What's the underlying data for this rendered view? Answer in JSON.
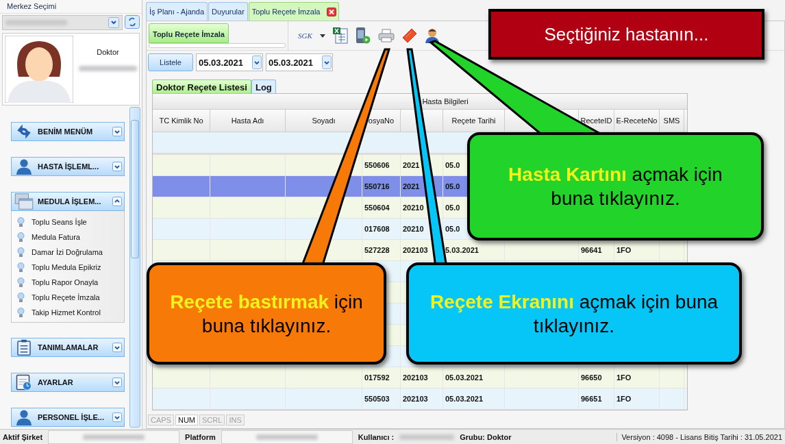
{
  "sidebar": {
    "center_label": "Merkez Seçimi",
    "role": "Doktor",
    "groups": [
      {
        "label": "BENİM MENÜM",
        "expanded": false
      },
      {
        "label": "HASTA İŞLEML...",
        "expanded": false
      },
      {
        "label": "MEDULA İŞLEM...",
        "expanded": true,
        "items": [
          "Toplu Seans İşle",
          "Medula Fatura",
          "Damar İzi Doğrulama",
          "Toplu Medula Epikriz",
          "Toplu Rapor Onayla",
          "Toplu Reçete İmzala",
          "Takip Hizmet Kontrol"
        ]
      },
      {
        "label": "TANIMLAMALAR",
        "expanded": false
      },
      {
        "label": "AYARLAR",
        "expanded": false
      },
      {
        "label": "PERSONEL İŞLE...",
        "expanded": false
      }
    ]
  },
  "tabs": [
    {
      "label": "İş Planı - Ajanda",
      "selected": false
    },
    {
      "label": "Duyurular",
      "selected": false
    },
    {
      "label": "Toplu Reçete İmzala",
      "selected": true
    }
  ],
  "ribbon_tab": "Toplu Reçete İmzala",
  "sgk_logo": "SGK",
  "list_button": "Listele",
  "date_from": "05.03.2021",
  "date_to": "05.03.2021",
  "inner_tabs": [
    {
      "label": "Doktor Reçete Listesi",
      "selected": true
    },
    {
      "label": "Log",
      "selected": false
    }
  ],
  "table": {
    "group_header": "Hasta Bilgileri",
    "columns": [
      {
        "label": "TC Kimlik No"
      },
      {
        "label": "Hasta Adı"
      },
      {
        "label": "Soyadı"
      },
      {
        "label": "osyaNo"
      },
      {},
      {
        "label": "Reçete Tarihi"
      },
      {},
      {
        "label": "ReceteID"
      },
      {
        "label": "E-ReceteNo"
      },
      {
        "label": "SMS"
      }
    ],
    "rows": [
      {
        "selected": false,
        "dosya_no": "550606",
        "column_5": "2021",
        "recete_tarihi": "05.0"
      },
      {
        "selected": true,
        "dosya_no": "550716",
        "column_5": "2021",
        "recete_tarihi": "05.0"
      },
      {
        "selected": false,
        "dosya_no": "550604",
        "column_5": "20210",
        "recete_tarihi": "05.0"
      },
      {
        "selected": false,
        "dosya_no": "017608",
        "column_5": "20210",
        "recete_tarihi": "05.0"
      },
      {
        "selected": false,
        "dosya_no": "527228",
        "column_5": "202103",
        "recete_tarihi": "5.03.2021",
        "recete_id": "96641",
        "e_recete_no": "1FO"
      },
      {
        "selected": false
      },
      {
        "selected": false
      },
      {
        "selected": false
      },
      {
        "selected": false
      },
      {
        "selected": false
      },
      {
        "selected": false,
        "dosya_no": "017592",
        "column_5": "202103",
        "recete_tarihi": "05.03.2021",
        "recete_id": "96650",
        "e_recete_no": "1FO"
      },
      {
        "selected": false,
        "dosya_no": "550503",
        "column_5": "202103",
        "recete_tarihi": "05.03.2021",
        "recete_id": "96651",
        "e_recete_no": "1FO"
      }
    ]
  },
  "key_indicators": [
    {
      "label": "CAPS",
      "on": false
    },
    {
      "label": "NUM",
      "on": true
    },
    {
      "label": "SCRL",
      "on": false
    },
    {
      "label": "INS",
      "on": false
    }
  ],
  "status_bar": {
    "company_label": "Aktif Şirket",
    "platform_label": "Platform",
    "user_label": "Kullanıcı :",
    "group": "Grubu: Doktor",
    "version": "Versiyon : 4098 - Lisans Bitiş Tarihi : 31.05.2021"
  },
  "callouts": [
    {
      "kind": "banner",
      "color": "#b00012",
      "text": "Seçtiğiniz hastanın..."
    },
    {
      "kind": "pointer",
      "color": "#22d42a",
      "text": "**Hasta Kartını** açmak için buna tıklayınız."
    },
    {
      "kind": "pointer",
      "color": "#f77a08",
      "text": "**Reçete bastırmak** için buna tıklayınız."
    },
    {
      "kind": "pointer",
      "color": "#06c6f8",
      "text": "**Reçete Ekranını** açmak için buna tıklayınız."
    }
  ]
}
